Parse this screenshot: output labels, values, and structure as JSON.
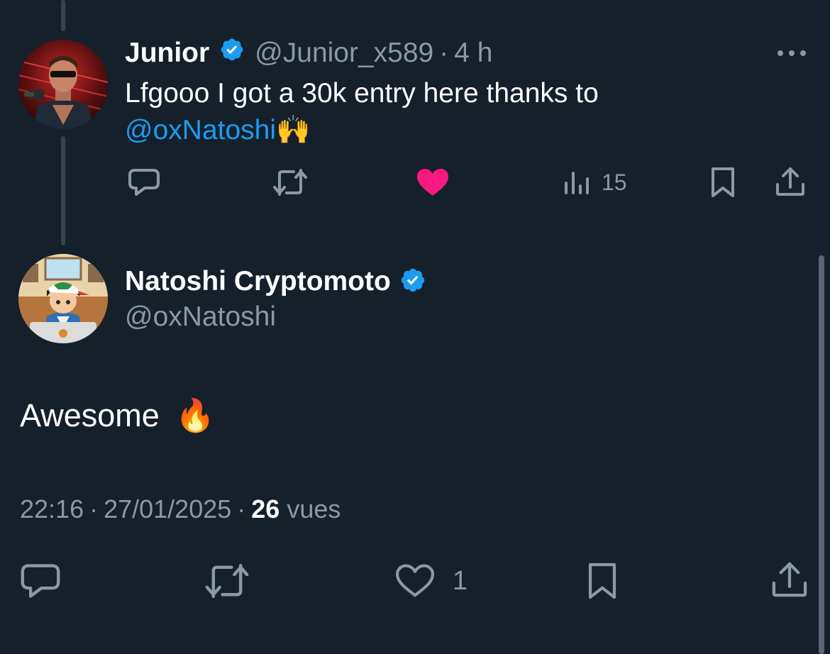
{
  "reply": {
    "author_name": "Junior",
    "handle": "@Junior_x589",
    "separator": "·",
    "time": "4 h",
    "text_main": "Lfgooo I got a 30k entry here thanks to",
    "mention": "@oxNatoshi",
    "emoji": "🙌",
    "views_count": "15",
    "liked": true,
    "like_color": "#f91880"
  },
  "tweet": {
    "author_name": "Natoshi Cryptomoto",
    "handle": "@oxNatoshi",
    "text": "Awesome",
    "emoji": "🔥",
    "time": "22:16",
    "date": "27/01/2025",
    "views_count": "26",
    "views_label": "vues",
    "like_count": "1"
  },
  "colors": {
    "background": "#15202b",
    "muted": "#8b98a5",
    "accent": "#1d9bf0",
    "like": "#f91880",
    "verified": "#1d9bf0"
  },
  "icons": [
    "verified-icon",
    "more-icon",
    "reply-icon",
    "retweet-icon",
    "like-icon",
    "views-icon",
    "bookmark-icon",
    "share-icon"
  ]
}
